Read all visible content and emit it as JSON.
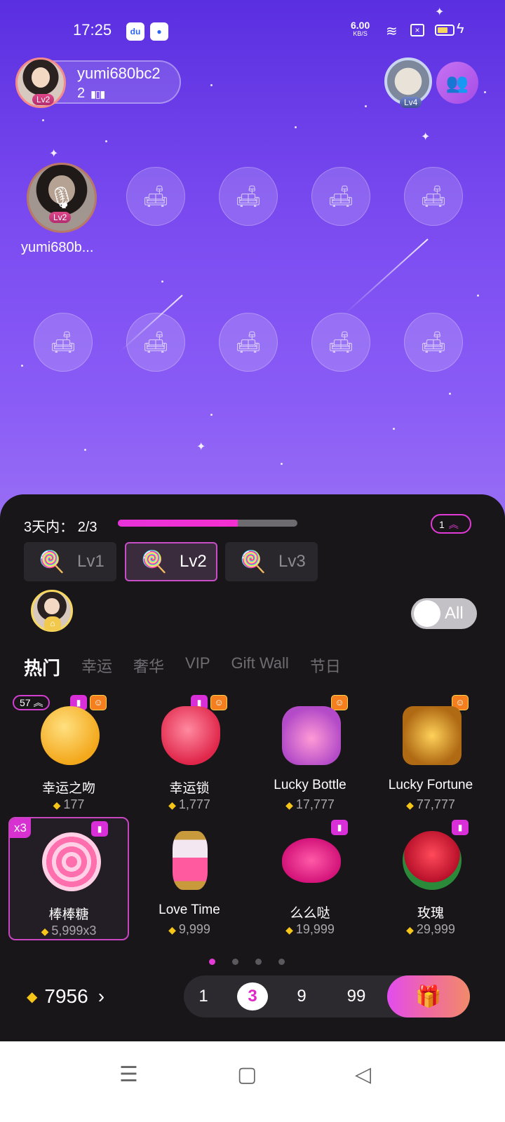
{
  "status_bar": {
    "time": "17:25",
    "net_speed": "6.00",
    "net_unit": "KB/S",
    "icons": [
      "baidu-app-icon",
      "app-icon",
      "wifi-icon",
      "sim-off-icon",
      "battery-icon",
      "charging-icon"
    ]
  },
  "owner": {
    "name": "yumi680bc2",
    "count": "2",
    "level": "Lv2"
  },
  "top_right": {
    "level": "Lv4"
  },
  "seats": {
    "host_name": "yumi680b...",
    "host_level": "Lv2",
    "empty_icon": "sofa-icon"
  },
  "panel": {
    "task_label": "3天内：",
    "task_progress": "2/3",
    "task_fraction": 0.667,
    "level_count": "1",
    "level_tabs": [
      {
        "label": "Lv1"
      },
      {
        "label": "Lv2"
      },
      {
        "label": "Lv3"
      }
    ],
    "toggle_label": "All",
    "categories": [
      "热门",
      "幸运",
      "奢华",
      "VIP",
      "Gift Wall",
      "节日"
    ],
    "gifts": [
      {
        "name": "幸运之吻",
        "price": "177",
        "count_badge": "57"
      },
      {
        "name": "幸运锁",
        "price": "1,777"
      },
      {
        "name": "Lucky Bottle",
        "price": "17,777"
      },
      {
        "name": "Lucky Fortune",
        "price": "77,777"
      },
      {
        "name": "棒棒糖",
        "price": "5,999x3",
        "multiplier": "x3"
      },
      {
        "name": "Love Time",
        "price": "9,999"
      },
      {
        "name": "么么哒",
        "price": "19,999"
      },
      {
        "name": "玫瑰",
        "price": "29,999"
      }
    ],
    "balance": "7956",
    "quantities": [
      "1",
      "3",
      "9",
      "99"
    ],
    "selected_quantity": "3"
  },
  "colors": {
    "accent": "#e23ad6",
    "room_bg_top": "#5a2fe0",
    "room_bg_bottom": "#9a70f4",
    "panel_bg": "#19161a",
    "diamond": "#f5c518"
  }
}
